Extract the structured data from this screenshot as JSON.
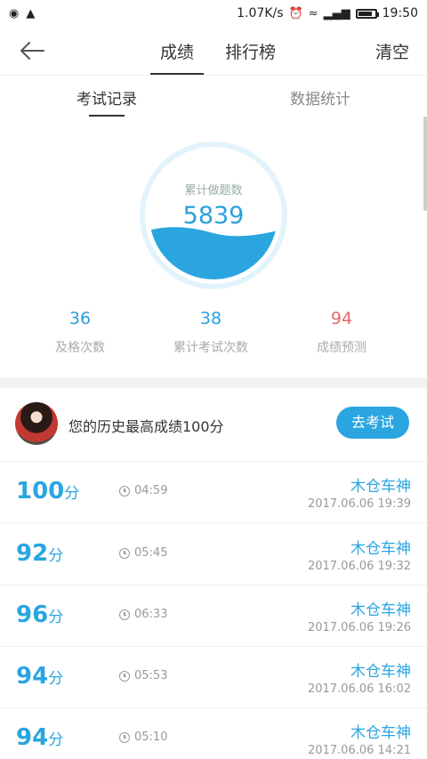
{
  "status_bar": {
    "speed": "1.07K/s",
    "time": "19:50",
    "left_icons": [
      "app-icon-1",
      "app-icon-2"
    ],
    "right_icons": [
      "alarm-icon",
      "wifi-icon",
      "signal-icon",
      "battery-icon"
    ]
  },
  "nav": {
    "back_icon": "back-arrow-icon",
    "tabs": [
      {
        "label": "成绩",
        "active": true
      },
      {
        "label": "排行榜",
        "active": false
      }
    ],
    "clear_label": "清空"
  },
  "sub_tabs": [
    {
      "label": "考试记录",
      "active": true
    },
    {
      "label": "数据统计",
      "active": false
    }
  ],
  "summary": {
    "gauge_label": "累计做题数",
    "gauge_value": "5839",
    "stats": [
      {
        "value": "36",
        "label": "及格次数"
      },
      {
        "value": "38",
        "label": "累计考试次数"
      },
      {
        "value": "94",
        "label": "成绩预测"
      }
    ]
  },
  "best": {
    "text": "您的历史最高成绩100分",
    "button": "去考试"
  },
  "records": [
    {
      "score": "100",
      "unit": "分",
      "duration": "04:59",
      "name": "木仓车神",
      "date": "2017.06.06  19:39"
    },
    {
      "score": "92",
      "unit": "分",
      "duration": "05:45",
      "name": "木仓车神",
      "date": "2017.06.06  19:32"
    },
    {
      "score": "96",
      "unit": "分",
      "duration": "06:33",
      "name": "木仓车神",
      "date": "2017.06.06  19:26"
    },
    {
      "score": "94",
      "unit": "分",
      "duration": "05:53",
      "name": "木仓车神",
      "date": "2017.06.06  16:02"
    },
    {
      "score": "94",
      "unit": "分",
      "duration": "05:10",
      "name": "木仓车神",
      "date": "2017.06.06  14:21"
    }
  ],
  "colors": {
    "accent": "#2aa5e0",
    "predict": "#e46a6a"
  }
}
